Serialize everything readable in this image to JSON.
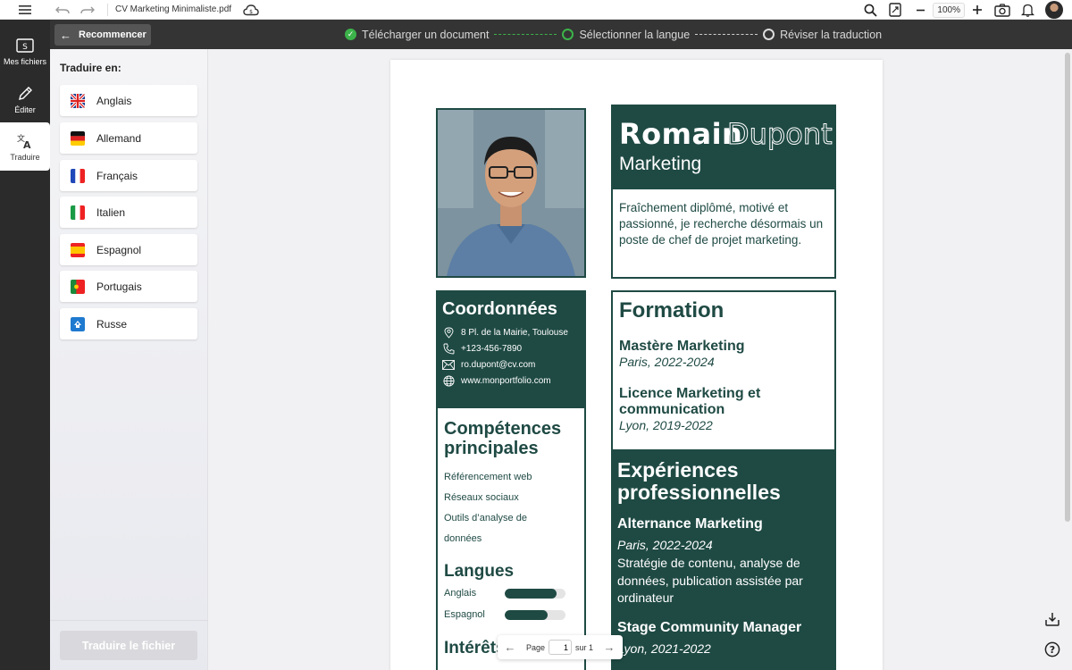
{
  "topbar": {
    "filename": "CV Marketing Minimaliste.pdf",
    "zoom": "100%",
    "icons": [
      "menu-icon",
      "undo-icon",
      "redo-icon",
      "cloud-sync-icon",
      "search-icon",
      "page-fit-icon",
      "zoom-out-icon",
      "zoom-in-icon",
      "screenshot-icon",
      "bell-icon",
      "user-avatar"
    ]
  },
  "stepbar": {
    "restart_label": "Recommencer",
    "steps": [
      {
        "label": "Télécharger un document",
        "state": "done"
      },
      {
        "label": "Sélectionner la langue",
        "state": "active"
      },
      {
        "label": "Réviser la traduction",
        "state": "todo"
      }
    ]
  },
  "leftnav": {
    "items": [
      {
        "label": "Mes fichiers",
        "icon": "folder-icon"
      },
      {
        "label": "Éditer",
        "icon": "pen-icon"
      },
      {
        "label": "Traduire",
        "icon": "translate-icon"
      }
    ]
  },
  "langpanel": {
    "title": "Traduire en:",
    "languages": [
      {
        "label": "Anglais",
        "flag": "uk-flag-icon"
      },
      {
        "label": "Allemand",
        "flag": "germany-flag-icon"
      },
      {
        "label": "Français",
        "flag": "france-flag-icon"
      },
      {
        "label": "Italien",
        "flag": "italy-flag-icon"
      },
      {
        "label": "Espagnol",
        "flag": "spain-flag-icon"
      },
      {
        "label": "Portugais",
        "flag": "portugal-flag-icon"
      },
      {
        "label": "Russe",
        "flag": "russia-flag-icon"
      }
    ],
    "translate_button": "Traduire le fichier"
  },
  "cv": {
    "first_name": "Romain",
    "last_name": "Dupont",
    "job_title": "Marketing",
    "summary": "Fraîchement diplômé, motivé et passionné, je recherche désormais un poste de chef de projet marketing.",
    "contact_title": "Coordonnées",
    "contacts": [
      {
        "icon": "location-pin-icon",
        "text": "8 Pl. de la Mairie, Toulouse"
      },
      {
        "icon": "phone-icon",
        "text": "+123-456-7890"
      },
      {
        "icon": "mail-icon",
        "text": "ro.dupont@cv.com"
      },
      {
        "icon": "globe-icon",
        "text": "www.monportfolio.com"
      }
    ],
    "skills_title": "Compétences principales",
    "skills": [
      "Référencement web",
      "Réseaux sociaux",
      "Outils d’analyse de",
      "données"
    ],
    "languages_title": "Langues",
    "languages": [
      {
        "name": "Anglais",
        "level": 0.85
      },
      {
        "name": "Espagnol",
        "level": 0.7
      }
    ],
    "interests_title": "Intérêts",
    "formation_title": "Formation",
    "formation": [
      {
        "degree": "Mastère Marketing",
        "sub": "Paris, 2022-2024"
      },
      {
        "degree": "Licence Marketing et communication",
        "sub": "Lyon, 2019-2022"
      }
    ],
    "experience_title": "Expériences professionnelles",
    "experience": [
      {
        "title": "Alternance Marketing",
        "date": "Paris, 2022-2024",
        "desc": "Stratégie de contenu, analyse de données, publication assistée par ordinateur"
      },
      {
        "title": "Stage Community Manager",
        "date": "Lyon, 2021-2022"
      }
    ]
  },
  "pager": {
    "label": "Page",
    "current": "1",
    "of_label": "sur 1"
  },
  "colors": {
    "cv_green": "#1f4a44",
    "step_green": "#3cb34a",
    "nav_dark": "#2b2b2b"
  }
}
